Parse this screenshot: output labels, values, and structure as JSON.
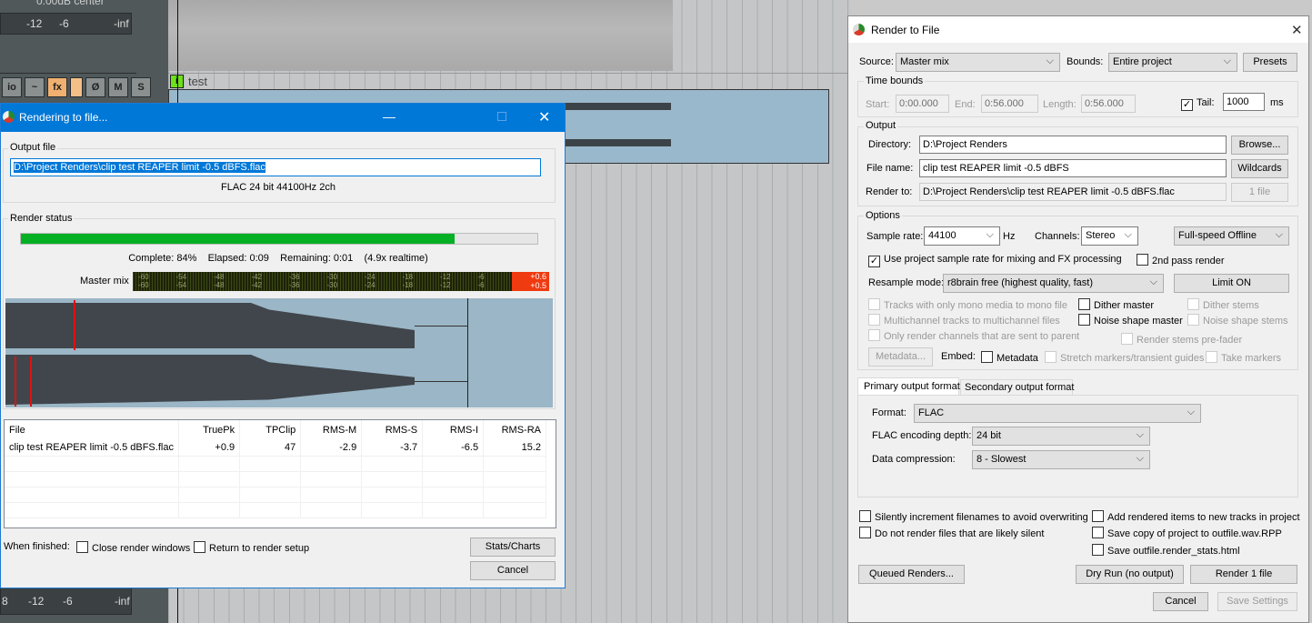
{
  "daw": {
    "pan_label": "0.00dB center",
    "meter_top": [
      "-12",
      "-6",
      "-inf"
    ],
    "meter_bottom": [
      "8",
      "-12",
      "-6",
      "-inf"
    ],
    "track_buttons": [
      "io",
      "~",
      "fx",
      "",
      "Ø",
      "M",
      "S"
    ],
    "track_name": "test"
  },
  "progress_window": {
    "title": "Rendering to file...",
    "output_file_label": "Output file",
    "output_path": "D:\\Project Renders\\clip test REAPER limit -0.5 dBFS.flac",
    "format_info": "FLAC 24 bit 44100Hz 2ch",
    "render_status_label": "Render status",
    "progress_percent": 84,
    "status_line": "Complete: 84%    Elapsed: 0:09    Remaining: 0:01    (4.9x realtime)",
    "meter_label": "Master mix",
    "meter_ticks": [
      "-60",
      "-54",
      "-48",
      "-42",
      "-36",
      "-30",
      "-24",
      "-18",
      "-12",
      "-6"
    ],
    "meter_peaks": [
      "+0.6",
      "+0.5"
    ],
    "stats_columns": [
      "File",
      "TruePk",
      "TPClip",
      "RMS-M",
      "RMS-S",
      "RMS-I",
      "RMS-RA"
    ],
    "stats_rows": [
      [
        "clip test REAPER limit -0.5 dBFS.flac",
        "+0.9",
        "47",
        "-2.9",
        "-3.7",
        "-6.5",
        "15.2"
      ]
    ],
    "when_finished_label": "When finished:",
    "close_windows_label": "Close render windows",
    "return_setup_label": "Return to render setup",
    "stats_button": "Stats/Charts",
    "cancel_button": "Cancel"
  },
  "render_dialog": {
    "title": "Render to File",
    "source_label": "Source:",
    "source_value": "Master mix",
    "bounds_label": "Bounds:",
    "bounds_value": "Entire project",
    "presets_button": "Presets",
    "time_bounds_label": "Time bounds",
    "start_label": "Start:",
    "start_value": "0:00.000",
    "end_label": "End:",
    "end_value": "0:56.000",
    "length_label": "Length:",
    "length_value": "0:56.000",
    "tail_label": "Tail:",
    "tail_value": "1000",
    "tail_unit": "ms",
    "output_label": "Output",
    "directory_label": "Directory:",
    "directory_value": "D:\\Project Renders",
    "browse_button": "Browse...",
    "filename_label": "File name:",
    "filename_value": "clip test REAPER limit -0.5 dBFS",
    "wildcards_button": "Wildcards",
    "renderto_label": "Render to:",
    "renderto_value": "D:\\Project Renders\\clip test REAPER limit -0.5 dBFS.flac",
    "files_button": "1 file",
    "options_label": "Options",
    "samplerate_label": "Sample rate:",
    "samplerate_value": "44100",
    "hz": "Hz",
    "channels_label": "Channels:",
    "channels_value": "Stereo",
    "speed_value": "Full-speed Offline",
    "use_project_rate": "Use project sample rate for mixing and FX processing",
    "second_pass": "2nd pass render",
    "resample_label": "Resample mode:",
    "resample_value": "r8brain free (highest quality, fast)",
    "limit_button": "Limit ON",
    "mono_media": "Tracks with only mono media to mono file",
    "multichannel": "Multichannel tracks to multichannel files",
    "only_parent": "Only render channels that are sent to parent",
    "dither_master": "Dither master",
    "noise_master": "Noise shape master",
    "dither_stems": "Dither stems",
    "noise_stems": "Noise shape stems",
    "stems_prefader": "Render stems pre-fader",
    "metadata_button": "Metadata...",
    "embed_label": "Embed:",
    "embed_metadata": "Metadata",
    "stretch_markers": "Stretch markers/transient guides",
    "take_markers": "Take markers",
    "tab_primary": "Primary output format",
    "tab_secondary": "Secondary output format",
    "format_label": "Format:",
    "format_value": "FLAC",
    "depth_label": "FLAC encoding depth:",
    "depth_value": "24 bit",
    "compression_label": "Data compression:",
    "compression_value": "8 - Slowest",
    "silently_increment": "Silently increment filenames to avoid overwriting",
    "no_silent": "Do not render files that are likely silent",
    "add_to_tracks": "Add rendered items to new tracks in project",
    "save_copy": "Save copy of project to outfile.wav.RPP",
    "save_stats": "Save outfile.render_stats.html",
    "queued_button": "Queued Renders...",
    "dryrun_button": "Dry Run (no output)",
    "render_button": "Render 1 file",
    "cancel_button": "Cancel",
    "save_settings_button": "Save Settings"
  }
}
